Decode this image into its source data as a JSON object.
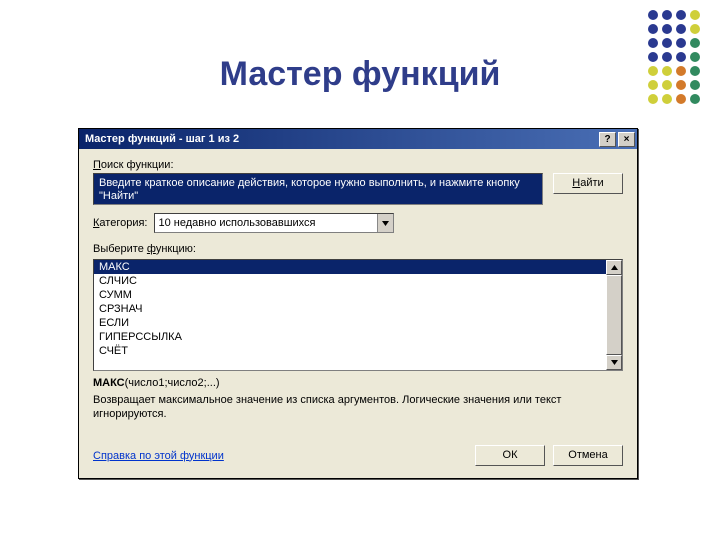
{
  "slide": {
    "title": "Мастер функций"
  },
  "deco_colors": [
    "#2a3990",
    "#2a3990",
    "#2a3990",
    "#cfcf3a",
    "#2a3990",
    "#2a3990",
    "#2a3990",
    "#cfcf3a",
    "#2a3990",
    "#2a3990",
    "#2a3990",
    "#318a5f",
    "#2a3990",
    "#2a3990",
    "#2a3990",
    "#318a5f",
    "#cfcf3a",
    "#cfcf3a",
    "#d37a2a",
    "#318a5f",
    "#cfcf3a",
    "#cfcf3a",
    "#d37a2a",
    "#318a5f",
    "#cfcf3a",
    "#cfcf3a",
    "#d37a2a",
    "#318a5f"
  ],
  "dialog": {
    "title": "Мастер функций - шаг 1 из 2",
    "help_btn": "?",
    "close_btn": "×",
    "search_label": "Поиск функции:",
    "search_value": "Введите краткое описание действия, которое нужно выполнить, и нажмите кнопку \"Найти\"",
    "find_btn": "Найти",
    "find_btn_ul": "Н",
    "category_label": "Категория:",
    "category_value": "10 недавно использовавшихся",
    "choose_label": "Выберите функцию:",
    "functions": [
      "МАКС",
      "СЛЧИС",
      "СУММ",
      "СРЗНАЧ",
      "ЕСЛИ",
      "ГИПЕРССЫЛКА",
      "СЧЁТ"
    ],
    "selected_index": 0,
    "signature_name": "МАКС",
    "signature_args": "(число1;число2;...)",
    "description": "Возвращает максимальное значение из списка аргументов. Логические значения или текст игнорируются.",
    "help_link": "Справка по этой функции",
    "ok_btn": "ОК",
    "cancel_btn": "Отмена"
  }
}
